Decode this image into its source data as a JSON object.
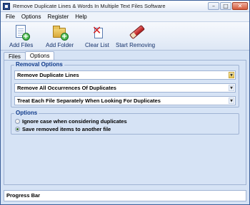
{
  "window": {
    "title": "Remove Duplicate Lines & Words In Multiple Text Files Software",
    "icon": "app-icon"
  },
  "menubar": {
    "items": [
      "File",
      "Options",
      "Register",
      "Help"
    ]
  },
  "toolbar": {
    "add_files": "Add Files",
    "add_folder": "Add Folder",
    "clear_list": "Clear List",
    "start_removing": "Start Removing"
  },
  "tabs": {
    "items": [
      "Files",
      "Options"
    ],
    "active": "Options"
  },
  "removal_options": {
    "title": "Removal Options",
    "mode": "Remove Duplicate Lines",
    "occurrence": "Remove All Occurrences Of Duplicates",
    "scope": "Treat Each File Separately When Looking For Duplicates"
  },
  "options": {
    "title": "Options",
    "ignore_case": "Ignore case when considering duplicates",
    "save_removed": "Save removed items to another file",
    "selected": "save_removed"
  },
  "status": {
    "progress": "Progress Bar"
  },
  "colors": {
    "accent": "#0f3a8a",
    "panel": "#d6e3f5",
    "border": "#9fb3d3"
  }
}
